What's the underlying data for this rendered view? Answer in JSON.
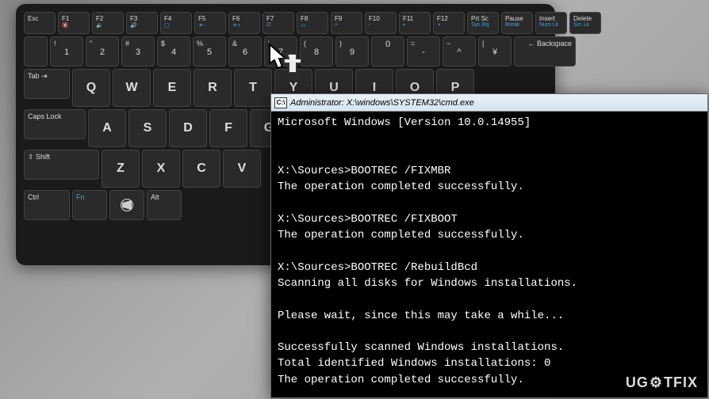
{
  "keyboard": {
    "fn_row": [
      {
        "main": "Esc",
        "sub": ""
      },
      {
        "main": "F1",
        "sub": "🔇"
      },
      {
        "main": "F2",
        "sub": "🔉"
      },
      {
        "main": "F3",
        "sub": "🔊"
      },
      {
        "main": "F4",
        "sub": "▢"
      },
      {
        "main": "F5",
        "sub": "☀-"
      },
      {
        "main": "F6",
        "sub": "☀+"
      },
      {
        "main": "F7",
        "sub": "⎚"
      },
      {
        "main": "F8",
        "sub": "▭"
      },
      {
        "main": "F9",
        "sub": "+"
      },
      {
        "main": "F10",
        "sub": "-"
      },
      {
        "main": "F11",
        "sub": "◐"
      },
      {
        "main": "F12",
        "sub": "◑"
      },
      {
        "main": "Prt Sc",
        "sub": "Sys Rq"
      },
      {
        "main": "Pause",
        "sub": "Break"
      },
      {
        "main": "Insert",
        "sub": "Num Lk"
      },
      {
        "main": "Delete",
        "sub": "Scr Lk"
      }
    ],
    "num_row": [
      {
        "top": "!",
        "main": "1"
      },
      {
        "top": "\"",
        "main": "2"
      },
      {
        "top": "#",
        "main": "3"
      },
      {
        "top": "$",
        "main": "4"
      },
      {
        "top": "%",
        "main": "5"
      },
      {
        "top": "&",
        "main": "6"
      },
      {
        "top": "'",
        "main": "7"
      },
      {
        "top": "(",
        "main": "8"
      },
      {
        "top": ")",
        "main": "9"
      },
      {
        "top": "",
        "main": "0"
      },
      {
        "top": "=",
        "main": "-"
      },
      {
        "top": "~",
        "main": "^"
      },
      {
        "top": "|",
        "main": "¥"
      }
    ],
    "num_row_end": "← Backspace",
    "qwerty_label": "Tab",
    "qwerty": [
      "Q",
      "W",
      "E",
      "R",
      "T",
      "Y",
      "U",
      "I",
      "O",
      "P"
    ],
    "caps_label": "Caps Lock",
    "asdf": [
      "A",
      "S",
      "D",
      "F",
      "G"
    ],
    "shift_label": "⇧ Shift",
    "zxcv": [
      "Z",
      "X",
      "C",
      "V"
    ],
    "bottom": {
      "ctrl": "Ctrl",
      "fn": "Fn",
      "win": "⊞",
      "alt": "Alt"
    }
  },
  "cmd": {
    "title": "Administrator: X:\\windows\\SYSTEM32\\cmd.exe",
    "icon": "C:\\",
    "lines": [
      "Microsoft Windows [Version 10.0.14955]",
      "",
      "",
      "X:\\Sources>BOOTREC /FIXMBR",
      "The operation completed successfully.",
      "",
      "X:\\Sources>BOOTREC /FIXBOOT",
      "The operation completed successfully.",
      "",
      "X:\\Sources>BOOTREC /RebuildBcd",
      "Scanning all disks for Windows installations.",
      "",
      "Please wait, since this may take a while...",
      "",
      "Successfully scanned Windows installations.",
      "Total identified Windows installations: 0",
      "The operation completed successfully."
    ]
  },
  "watermark": {
    "pre": "UG",
    "mid": "⚙",
    "post": "TFIX"
  }
}
